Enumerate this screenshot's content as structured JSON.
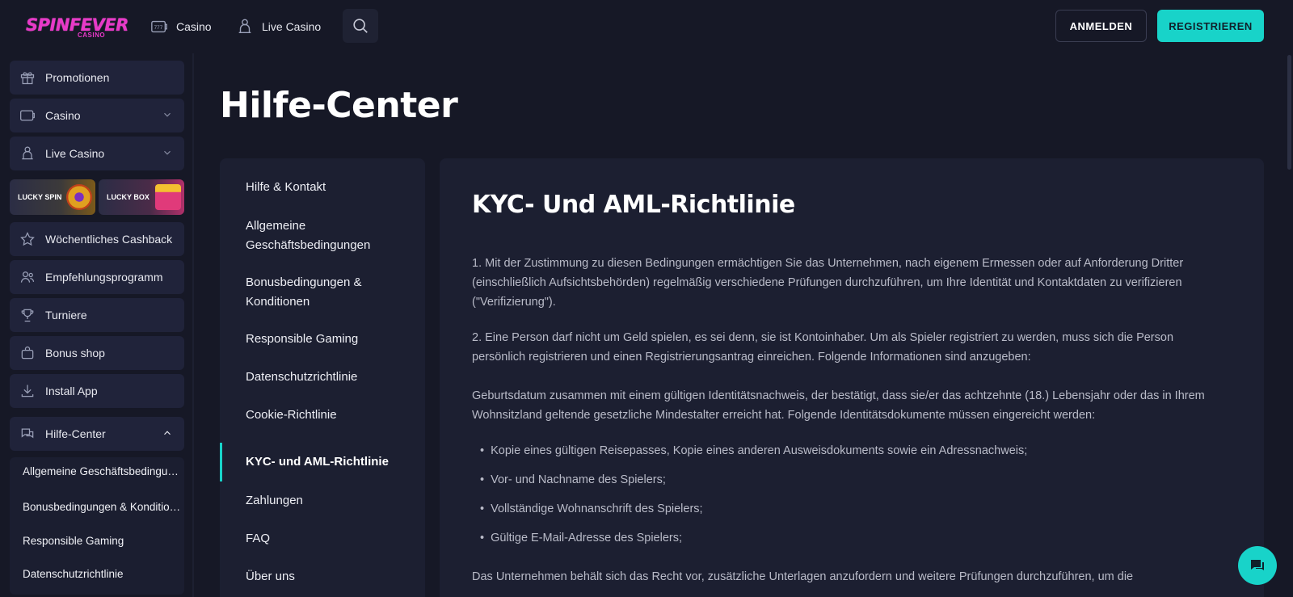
{
  "header": {
    "logo_main": "SPINFEVER",
    "logo_sub": "CASINO",
    "nav": [
      {
        "label": "Casino",
        "icon": "slot-777-icon"
      },
      {
        "label": "Live Casino",
        "icon": "dealer-icon"
      }
    ],
    "login_label": "ANMELDEN",
    "register_label": "REGISTRIEREN"
  },
  "sidebar": {
    "items": [
      {
        "label": "Promotionen",
        "icon": "gift-icon"
      },
      {
        "label": "Casino",
        "icon": "slot-777-icon"
      },
      {
        "label": "Live Casino",
        "icon": "dealer-icon"
      },
      {
        "label": "Wöchentliches Cashback",
        "icon": "star-icon"
      },
      {
        "label": "Empfehlungsprogramm",
        "icon": "users-icon"
      },
      {
        "label": "Turniere",
        "icon": "trophy-icon"
      },
      {
        "label": "Bonus shop",
        "icon": "bag-icon"
      },
      {
        "label": "Install App",
        "icon": "download-icon"
      },
      {
        "label": "Hilfe-Center",
        "icon": "chat-icon"
      }
    ],
    "promo_tiles": [
      {
        "label": "LUCKY SPIN"
      },
      {
        "label": "LUCKY BOX"
      }
    ],
    "help_sub_items": [
      "Allgemeine Geschäftsbedingungen",
      "Bonusbedingungen & Konditionen",
      "Responsible Gaming",
      "Datenschutzrichtlinie"
    ]
  },
  "main": {
    "page_title": "Hilfe-Center",
    "help_nav": [
      "Hilfe & Kontakt",
      "Allgemeine Geschäftsbedingungen",
      "Bonusbedingungen & Konditionen",
      "Responsible Gaming",
      "Datenschutzrichtlinie",
      "Cookie-Richtlinie",
      "KYC- und AML-Richtlinie",
      "Zahlungen",
      "FAQ",
      "Über uns"
    ],
    "active_help_item": "KYC- und AML-Richtlinie",
    "article": {
      "title": "KYC- Und AML-Richtlinie",
      "p1": "1. Mit der Zustimmung zu diesen Bedingungen ermächtigen Sie das Unternehmen, nach eigenem Ermessen oder auf Anforderung Dritter (einschließlich Aufsichtsbehörden) regelmäßig verschiedene Prüfungen durchzuführen, um Ihre Identität und Kontaktdaten zu verifizieren (\"Verifizierung\").",
      "p2": "2. Eine Person darf nicht um Geld spielen, es sei denn, sie ist Kontoinhaber. Um als Spieler registriert zu werden, muss sich die Person persönlich registrieren und einen Registrierungsantrag einreichen. Folgende Informationen sind anzugeben:",
      "p3": "Geburtsdatum zusammen mit einem gültigen Identitätsnachweis, der bestätigt, dass sie/er das achtzehnte (18.) Lebensjahr oder das in Ihrem Wohnsitzland geltende gesetzliche Mindestalter erreicht hat. Folgende Identitätsdokumente müssen eingereicht werden:",
      "bullets": [
        "Kopie eines gültigen Reisepasses, Kopie eines anderen Ausweisdokuments sowie ein Adressnachweis;",
        "Vor- und Nachname des Spielers;",
        "Vollständige Wohnanschrift des Spielers;",
        "Gültige E-Mail-Adresse des Spielers;"
      ],
      "p4": "Das Unternehmen behält sich das Recht vor, zusätzliche Unterlagen anzufordern und weitere Prüfungen durchzuführen, um die"
    }
  },
  "colors": {
    "accent": "#18d3c9",
    "brand": "#e839c8",
    "background": "#161826",
    "panel": "#1c1f31"
  }
}
